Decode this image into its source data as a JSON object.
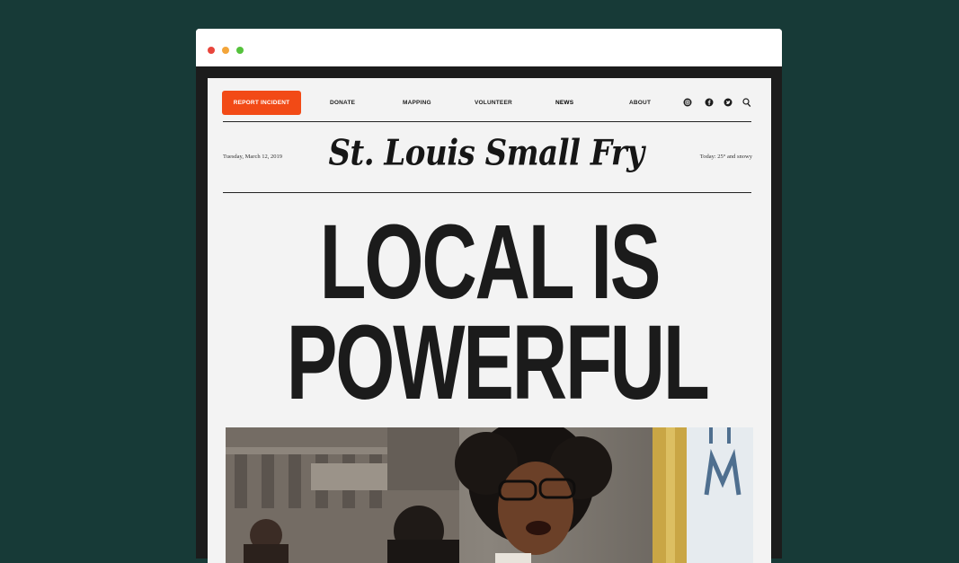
{
  "nav": {
    "report_label": "REPORT INCIDENT",
    "links": [
      "DONATE",
      "MAPPING",
      "VOLUNTEER",
      "NEWS",
      "ABOUT"
    ],
    "social_icons": [
      "instagram-icon",
      "facebook-icon",
      "twitter-icon",
      "search-icon"
    ]
  },
  "masthead": {
    "date": "Tuesday, March 12, 2019",
    "title": "St. Louis Small Fry",
    "weather": "Today: 25° and snowy"
  },
  "headline": {
    "line1": "LOCAL IS",
    "line2": "POWERFUL"
  },
  "colors": {
    "background": "#173a37",
    "accent": "#f24a16",
    "page": "#f3f3f3",
    "text": "#1b1b1b"
  }
}
